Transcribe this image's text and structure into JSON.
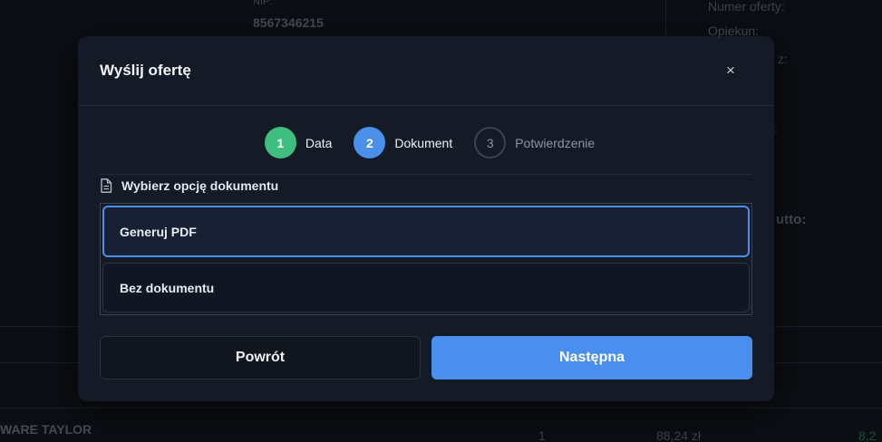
{
  "background": {
    "nip_label": "NIP:",
    "nip_value": "8567346215",
    "offer_number_label": "Numer oferty:",
    "guardian_label": "Opiekun:",
    "fragment_z": "z:",
    "fragment_colon": ":",
    "brutto_fragment": "utto:",
    "product_name": "WARE TAYLOR",
    "product_qty": "1",
    "product_price": "88,24 zł",
    "product_total": "8,2"
  },
  "modal": {
    "title": "Wyślij ofertę",
    "close_symbol": "×",
    "steps": [
      {
        "number": "1",
        "label": "Data",
        "state": "done"
      },
      {
        "number": "2",
        "label": "Dokument",
        "state": "active"
      },
      {
        "number": "3",
        "label": "Potwierdzenie",
        "state": "pending"
      }
    ],
    "section_label": "Wybierz opcję dokumentu",
    "options": [
      {
        "label": "Generuj PDF",
        "selected": true
      },
      {
        "label": "Bez dokumentu",
        "selected": false
      }
    ],
    "back_label": "Powrót",
    "next_label": "Następna"
  },
  "colors": {
    "accent": "#4a8fee",
    "success": "#3fbf7f",
    "modal_bg": "#141b27",
    "page_bg": "#0b0e13"
  }
}
